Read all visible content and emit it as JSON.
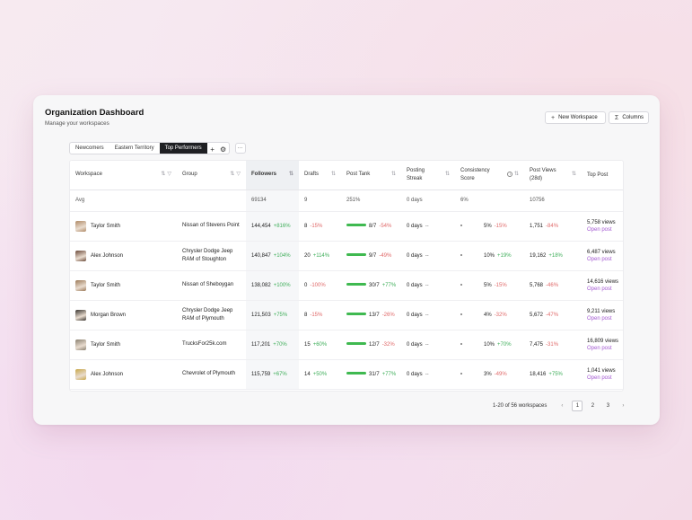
{
  "header": {
    "title": "Organization Dashboard",
    "subtitle": "Manage your workspaces",
    "new_workspace": "New Workspace",
    "columns": "Columns"
  },
  "tabs": [
    "Newcomers",
    "Eastern Territory",
    "Top Performers"
  ],
  "tab_more": "···",
  "columns": {
    "workspace": "Workspace",
    "group": "Group",
    "followers": "Followers",
    "drafts": "Drafts",
    "post_tank": "Post Tank",
    "posting_streak_1": "Posting",
    "posting_streak_2": "Streak",
    "consistency_1": "Consistency",
    "consistency_2": "Score",
    "views_1": "Post Views",
    "views_2": "(28d)",
    "top_post": "Top Post"
  },
  "avg": {
    "label": "Avg",
    "followers": "69134",
    "drafts": "9",
    "post_tank": "251%",
    "streak": "0 days",
    "consistency": "6%",
    "views": "10756"
  },
  "rows": [
    {
      "name": "Taylor Smith",
      "avatar_color": "#b08a66",
      "group": "Nissan of Stevens Point",
      "followers": "144,454",
      "followers_delta": "+816%",
      "drafts": "8",
      "drafts_delta": "-15%",
      "tank": "8/7",
      "tank_delta": "-54%",
      "tank_fill": 1.0,
      "streak": "0 days",
      "streak_dash": "--",
      "consistency": "5%",
      "consistency_delta": "-15%",
      "views": "1,751",
      "views_delta": "-84%",
      "top_views": "5,758 views",
      "open": "Open post"
    },
    {
      "name": "Alex Johnson",
      "avatar_color": "#6b4a3a",
      "group": "Chrysler Dodge Jeep RAM of Stoughton",
      "followers": "140,847",
      "followers_delta": "+104%",
      "drafts": "20",
      "drafts_delta": "+114%",
      "tank": "9/7",
      "tank_delta": "-49%",
      "tank_fill": 1.0,
      "streak": "0 days",
      "streak_dash": "--",
      "consistency": "10%",
      "consistency_delta": "+19%",
      "views": "19,162",
      "views_delta": "+18%",
      "top_views": "6,487 views",
      "open": "Open post"
    },
    {
      "name": "Taylor Smith",
      "avatar_color": "#9c7a58",
      "group": "Nissan of Sheboygan",
      "followers": "138,082",
      "followers_delta": "+100%",
      "drafts": "0",
      "drafts_delta": "-100%",
      "tank": "30/7",
      "tank_delta": "+77%",
      "tank_fill": 1.0,
      "streak": "0 days",
      "streak_dash": "--",
      "consistency": "5%",
      "consistency_delta": "-15%",
      "views": "5,768",
      "views_delta": "-46%",
      "top_views": "14,616 views",
      "open": "Open post"
    },
    {
      "name": "Morgan Brown",
      "avatar_color": "#3a3530",
      "group": "Chrysler Dodge Jeep RAM of Plymouth",
      "followers": "121,503",
      "followers_delta": "+75%",
      "drafts": "8",
      "drafts_delta": "-15%",
      "tank": "13/7",
      "tank_delta": "-26%",
      "tank_fill": 1.0,
      "streak": "0 days",
      "streak_dash": "--",
      "consistency": "4%",
      "consistency_delta": "-32%",
      "views": "5,672",
      "views_delta": "-47%",
      "top_views": "9,211 views",
      "open": "Open post"
    },
    {
      "name": "Taylor Smith",
      "avatar_color": "#8a8070",
      "group": "TrucksFor25k.com",
      "followers": "117,201",
      "followers_delta": "+70%",
      "drafts": "15",
      "drafts_delta": "+60%",
      "tank": "12/7",
      "tank_delta": "-32%",
      "tank_fill": 1.0,
      "streak": "0 days",
      "streak_dash": "--",
      "consistency": "10%",
      "consistency_delta": "+70%",
      "views": "7,475",
      "views_delta": "-31%",
      "top_views": "16,809 views",
      "open": "Open post"
    },
    {
      "name": "Alex Johnson",
      "avatar_color": "#c9a84a",
      "group": "Chevrolet of Plymouth",
      "followers": "115,759",
      "followers_delta": "+67%",
      "drafts": "14",
      "drafts_delta": "+50%",
      "tank": "31/7",
      "tank_delta": "+77%",
      "tank_fill": 1.0,
      "streak": "0 days",
      "streak_dash": "--",
      "consistency": "3%",
      "consistency_delta": "-49%",
      "views": "18,416",
      "views_delta": "+75%",
      "top_views": "1,041 views",
      "open": "Open post"
    }
  ],
  "pagination": {
    "summary": "1-20 of 56 workspaces",
    "prev": "‹",
    "pages": [
      "1",
      "2",
      "3"
    ],
    "next": "›"
  },
  "icons": {
    "plus": "+",
    "columns": "Σ",
    "gear": "⚙",
    "sort": "⇅",
    "filter": "▽",
    "info": "i"
  },
  "colors": {
    "positive": "#3fae5a",
    "negative": "#e06a6a",
    "link": "#a35ad1",
    "tank_bar": "#3fb950",
    "active_tab": "#1e1f22"
  }
}
